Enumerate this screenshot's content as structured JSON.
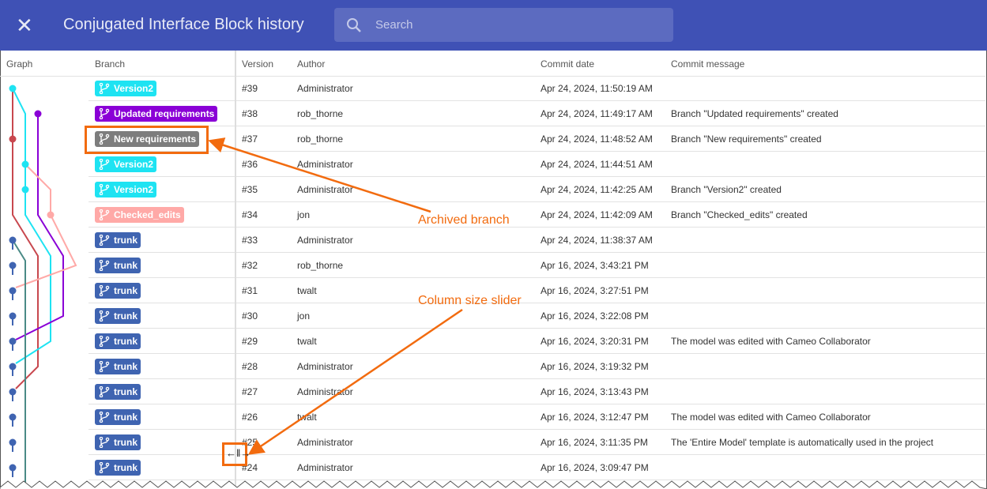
{
  "header": {
    "title": "Conjugated Interface Block history",
    "search_placeholder": "Search"
  },
  "columns": {
    "graph": "Graph",
    "branch": "Branch",
    "version": "Version",
    "author": "Author",
    "date": "Commit date",
    "message": "Commit message"
  },
  "branch_colors": {
    "Version2": "#1ee3f2",
    "Updated requirements": "#8a00d6",
    "New requirements": "#7d7d7d",
    "Checked_edits": "#ffa9a7",
    "trunk": "#3f64b1"
  },
  "rows": [
    {
      "branch": "Version2",
      "version": "#39",
      "author": "Administrator",
      "date": "Apr 24, 2024, 11:50:19 AM",
      "message": ""
    },
    {
      "branch": "Updated requirements",
      "version": "#38",
      "author": "rob_thorne",
      "date": "Apr 24, 2024, 11:49:17 AM",
      "message": "Branch \"Updated requirements\" created"
    },
    {
      "branch": "New requirements",
      "archived": true,
      "version": "#37",
      "author": "rob_thorne",
      "date": "Apr 24, 2024, 11:48:52 AM",
      "message": "Branch \"New requirements\" created"
    },
    {
      "branch": "Version2",
      "version": "#36",
      "author": "Administrator",
      "date": "Apr 24, 2024, 11:44:51 AM",
      "message": ""
    },
    {
      "branch": "Version2",
      "version": "#35",
      "author": "Administrator",
      "date": "Apr 24, 2024, 11:42:25 AM",
      "message": "Branch \"Version2\" created"
    },
    {
      "branch": "Checked_edits",
      "version": "#34",
      "author": "jon",
      "date": "Apr 24, 2024, 11:42:09 AM",
      "message": "Branch \"Checked_edits\" created"
    },
    {
      "branch": "trunk",
      "version": "#33",
      "author": "Administrator",
      "date": "Apr 24, 2024, 11:38:37 AM",
      "message": ""
    },
    {
      "branch": "trunk",
      "version": "#32",
      "author": "rob_thorne",
      "date": "Apr 16, 2024, 3:43:21 PM",
      "message": ""
    },
    {
      "branch": "trunk",
      "version": "#31",
      "author": "twalt",
      "date": "Apr 16, 2024, 3:27:51 PM",
      "message": ""
    },
    {
      "branch": "trunk",
      "version": "#30",
      "author": "jon",
      "date": "Apr 16, 2024, 3:22:08 PM",
      "message": ""
    },
    {
      "branch": "trunk",
      "version": "#29",
      "author": "twalt",
      "date": "Apr 16, 2024, 3:20:31 PM",
      "message": "The model was edited with Cameo Collaborator"
    },
    {
      "branch": "trunk",
      "version": "#28",
      "author": "Administrator",
      "date": "Apr 16, 2024, 3:19:32 PM",
      "message": ""
    },
    {
      "branch": "trunk",
      "version": "#27",
      "author": "Administrator",
      "date": "Apr 16, 2024, 3:13:43 PM",
      "message": ""
    },
    {
      "branch": "trunk",
      "version": "#26",
      "author": "twalt",
      "date": "Apr 16, 2024, 3:12:47 PM",
      "message": "The model was edited with Cameo Collaborator"
    },
    {
      "branch": "trunk",
      "version": "#25",
      "author": "Administrator",
      "date": "Apr 16, 2024, 3:11:35 PM",
      "message": "The 'Entire Model' template is automatically used in the project"
    },
    {
      "branch": "trunk",
      "version": "#24",
      "author": "Administrator",
      "date": "Apr 16, 2024, 3:09:47 PM",
      "message": ""
    }
  ],
  "annotations": {
    "archived": "Archived branch",
    "slider": "Column size slider",
    "accent": "#f26b0f"
  }
}
